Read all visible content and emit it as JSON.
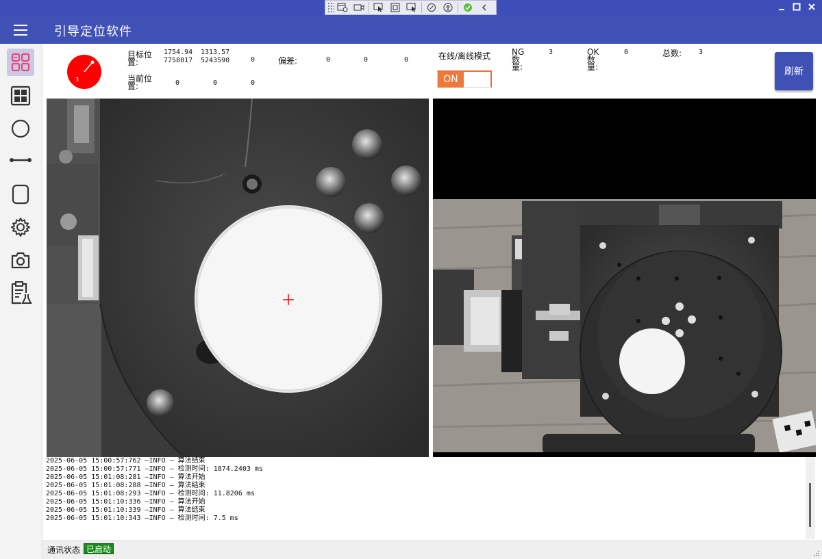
{
  "app": {
    "title": "引导定位软件"
  },
  "gauge": {
    "value": "3",
    "color": "#ff0000"
  },
  "target": {
    "label": "目标位置:",
    "x": "1754.94\n7758017",
    "y": "1313.57\n5243590",
    "z": "0"
  },
  "deviation": {
    "label": "偏差:",
    "x": "0",
    "y": "0",
    "z": "0"
  },
  "current": {
    "label": "当前位置:",
    "x": "0",
    "y": "0",
    "z": "0"
  },
  "mode": {
    "label": "在线/离线模式",
    "toggle_label": "ON",
    "toggle_color": "#ee7a39"
  },
  "stats": {
    "ng_label": "NG数量:",
    "ng_value": "3",
    "ok_label": "OK数量:",
    "ok_value": "0",
    "total_label": "总数:",
    "total_value": "3"
  },
  "refresh_label": "刷新",
  "log": {
    "lines": [
      "2025-06-05 15:00:57:762 —INFO — 算法结束",
      "2025-06-05 15:00:57:771 —INFO — 检测时间: 1874.2403 ms",
      "2025-06-05 15:01:08:281 —INFO — 算法开始",
      "2025-06-05 15:01:08:288 —INFO — 算法结束",
      "2025-06-05 15:01:08:293 —INFO — 检测时间: 11.8206 ms",
      "2025-06-05 15:01:10:336 —INFO — 算法开始",
      "2025-06-05 15:01:10:339 —INFO — 算法结束",
      "2025-06-05 15:01:10:343 —INFO — 检测时间: 7.5 ms"
    ]
  },
  "status": {
    "label": "通讯状态",
    "value": "已启动",
    "color": "#1a8a1a"
  },
  "sidebar": {
    "items": [
      {
        "icon": "dashboard-icon"
      },
      {
        "icon": "grid-icon"
      },
      {
        "icon": "circle-icon"
      },
      {
        "icon": "line-icon"
      },
      {
        "icon": "rounded-square-icon"
      },
      {
        "icon": "gear-icon"
      },
      {
        "icon": "camera-icon"
      },
      {
        "icon": "clipboard-icon"
      }
    ]
  }
}
